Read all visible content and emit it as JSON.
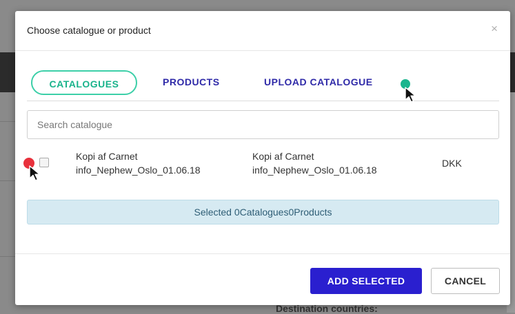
{
  "background": {
    "partial_label": "Destination countries:"
  },
  "dialog": {
    "title": "Choose catalogue or product",
    "close_glyph": "×"
  },
  "tabs": [
    {
      "label": "CATALOGUES",
      "active": true
    },
    {
      "label": "PRODUCTS",
      "active": false
    },
    {
      "label": "UPLOAD CATALOGUE",
      "active": false
    }
  ],
  "search": {
    "placeholder": "Search catalogue",
    "value": ""
  },
  "catalogue_row": {
    "checked": false,
    "name_line1": "Kopi af Carnet",
    "name_line2": "info_Nephew_Oslo_01.06.18",
    "file_line1": "Kopi af Carnet",
    "file_line2": "info_Nephew_Oslo_01.06.18",
    "currency": "DKK"
  },
  "selection_summary": "Selected 0Catalogues0Products",
  "footer": {
    "add_label": "ADD SELECTED",
    "cancel_label": "CANCEL"
  },
  "colors": {
    "primary": "#2a1fcf",
    "tab_active": "#19b38b",
    "tab_text": "#2f2aa8",
    "info_bar": "#d6eaf2",
    "cursor_dot_teal": "#1bb58e",
    "cursor_dot_red": "#e8313c"
  }
}
